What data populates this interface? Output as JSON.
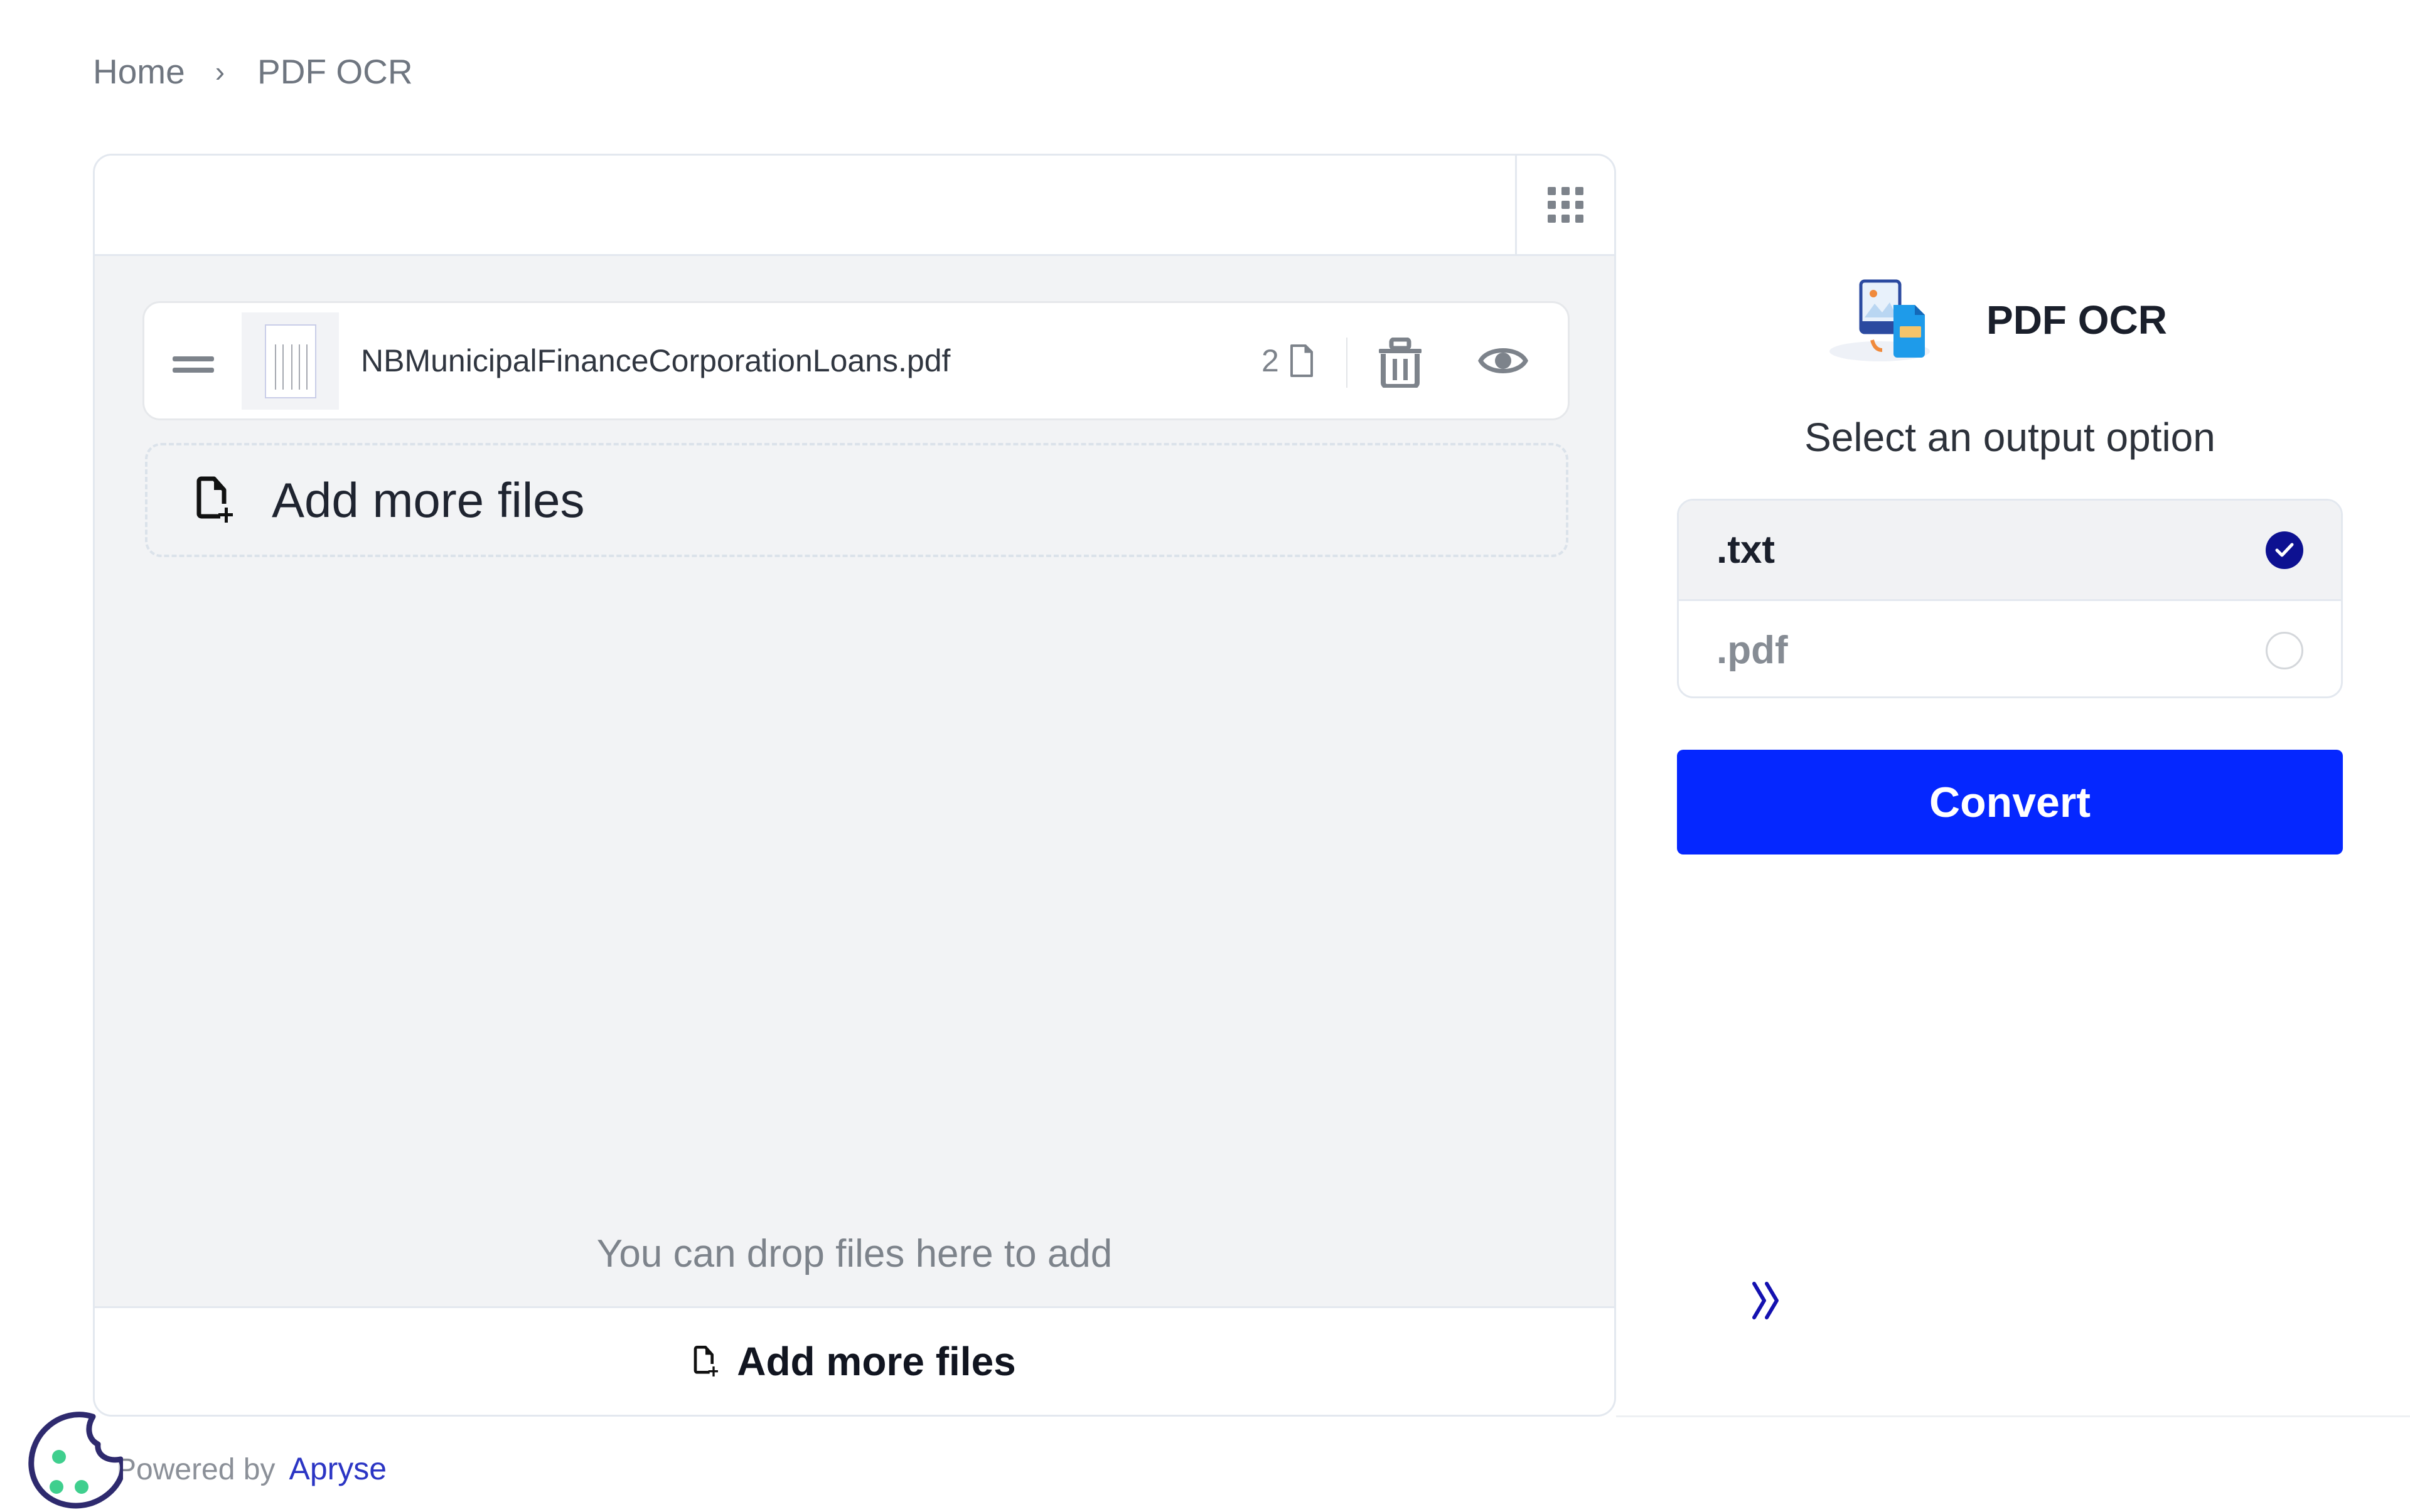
{
  "breadcrumb": {
    "items": [
      "Home",
      "PDF OCR"
    ],
    "separator": "›"
  },
  "file_panel": {
    "view_toggle_icon": "grid-icon",
    "files": [
      {
        "name": "NBMunicipalFinanceCorporationLoans.pdf",
        "page_count": "2",
        "actions": [
          "delete",
          "preview"
        ]
      }
    ],
    "add_more_label": "Add more files",
    "drop_hint": "You can drop files here to add",
    "footer_add_label": "Add more files"
  },
  "tool": {
    "title": "PDF OCR",
    "subtitle": "Select an output option",
    "options": [
      {
        "label": ".txt",
        "selected": true
      },
      {
        "label": ".pdf",
        "selected": false
      }
    ],
    "convert_label": "Convert",
    "expand_icon": "double-chevron-right-icon"
  },
  "footer": {
    "powered_by": "Powered by",
    "brand": "Apryse"
  },
  "colors": {
    "accent": "#0527ff",
    "radio_selected": "#0d1191",
    "brand_link": "#2b35c4",
    "cookie_outline": "#2e2a6e",
    "cookie_dots": "#3fcf8e"
  }
}
